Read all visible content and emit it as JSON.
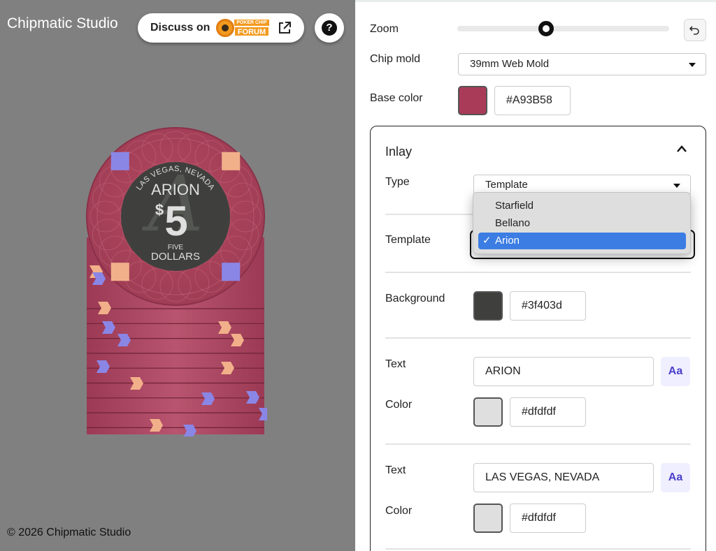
{
  "app": {
    "title": "Chipmatic Studio",
    "discuss_label": "Discuss on",
    "forum_logo_top": "POKER CHIP",
    "forum_logo_bottom": "FORUM",
    "help_label": "?",
    "copyright": "© 2026 Chipmatic Studio"
  },
  "chip_preview": {
    "top_text": "LAS VEGAS, NEVADA",
    "brand": "ARION",
    "denomination": "$5",
    "currency_symbol": "$",
    "amount": "5",
    "line1": "FIVE",
    "line2": "DOLLARS",
    "watermark_glyph": "A",
    "base_color": "#A93B58",
    "inlay_color": "#3f403d",
    "text_color": "#dfdfdf",
    "spot_color_a": "#f2b08a",
    "spot_color_b": "#8a86e6"
  },
  "controls": {
    "zoom_label": "Zoom",
    "zoom_value": 0.42,
    "chip_mold_label": "Chip mold",
    "chip_mold_value": "39mm Web Mold",
    "base_color_label": "Base color",
    "base_color_value": "#A93B58"
  },
  "inlay": {
    "title": "Inlay",
    "type_label": "Type",
    "type_value": "Template",
    "type_options": [
      {
        "label": "Starfield",
        "selected": false
      },
      {
        "label": "Bellano",
        "selected": false
      },
      {
        "label": "Arion",
        "selected": true
      }
    ],
    "check_mark": "✓",
    "template_label": "Template",
    "background_label": "Background",
    "background_value": "#3f403d",
    "text_fields": [
      {
        "label": "Text",
        "value": "ARION",
        "font_btn": "Aa",
        "color_label": "Color",
        "color_value": "#dfdfdf"
      },
      {
        "label": "Text",
        "value": "LAS VEGAS, NEVADA",
        "font_btn": "Aa",
        "color_label": "Color",
        "color_value": "#dfdfdf"
      }
    ]
  }
}
